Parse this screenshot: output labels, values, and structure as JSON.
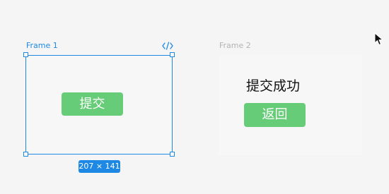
{
  "canvas": {
    "background": "#f5f5f5"
  },
  "frame1": {
    "label": "Frame 1",
    "button_label": "提交",
    "selected": true,
    "size_label": "207 × 141"
  },
  "frame2": {
    "label": "Frame 2",
    "message": "提交成功",
    "button_label": "返回"
  },
  "icons": {
    "code": "code-icon",
    "cursor": "cursor-icon"
  },
  "colors": {
    "selection": "#1e88e5",
    "button": "#66cc77",
    "frame_background": "#f7f7f7"
  }
}
